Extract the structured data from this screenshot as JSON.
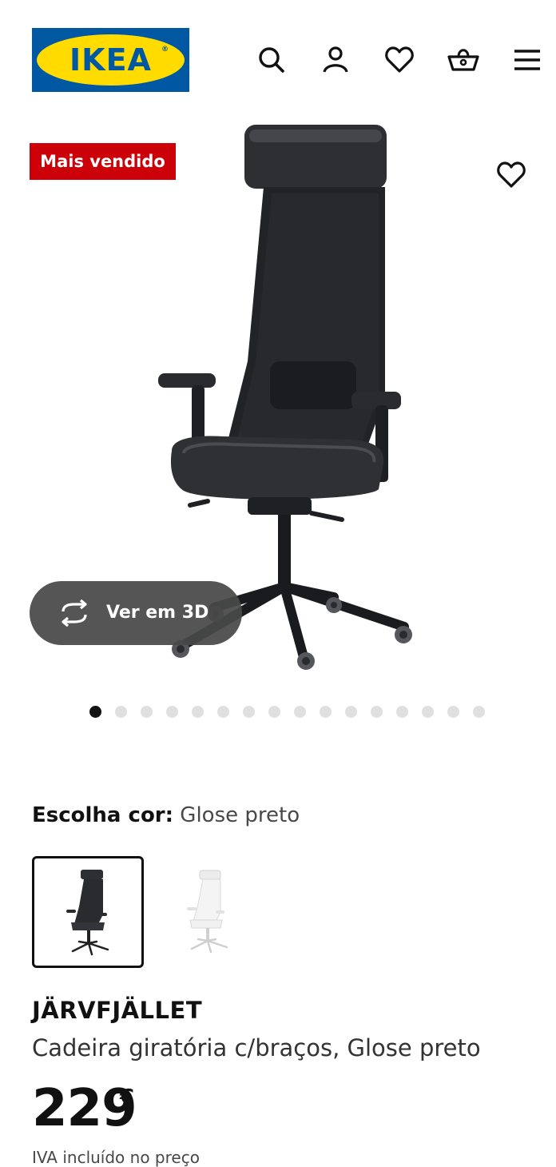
{
  "header": {
    "logo_text": "IKEA",
    "logo_registered": "®",
    "icons": [
      "search-icon",
      "account-icon",
      "heart-icon",
      "basket-icon",
      "menu-icon"
    ]
  },
  "hero": {
    "badge": "Mais vendido",
    "view_3d_label": "Ver em 3D",
    "image_count": 16,
    "active_image": 1
  },
  "color_select": {
    "label": "Escolha cor:",
    "value": "Glose preto",
    "options": [
      {
        "name": "Glose preto",
        "selected": true
      },
      {
        "name": "branco",
        "selected": false
      }
    ]
  },
  "product": {
    "name": "JÄRVFJÄLLET",
    "description": "Cadeira giratória c/braços, Glose preto",
    "price_integer": "229",
    "currency": "€",
    "vat_note": "IVA incluído no preço"
  },
  "colors": {
    "brand_blue": "#0058a3",
    "brand_yellow": "#ffdb00",
    "badge_red": "#cc0008",
    "text": "#111111"
  }
}
